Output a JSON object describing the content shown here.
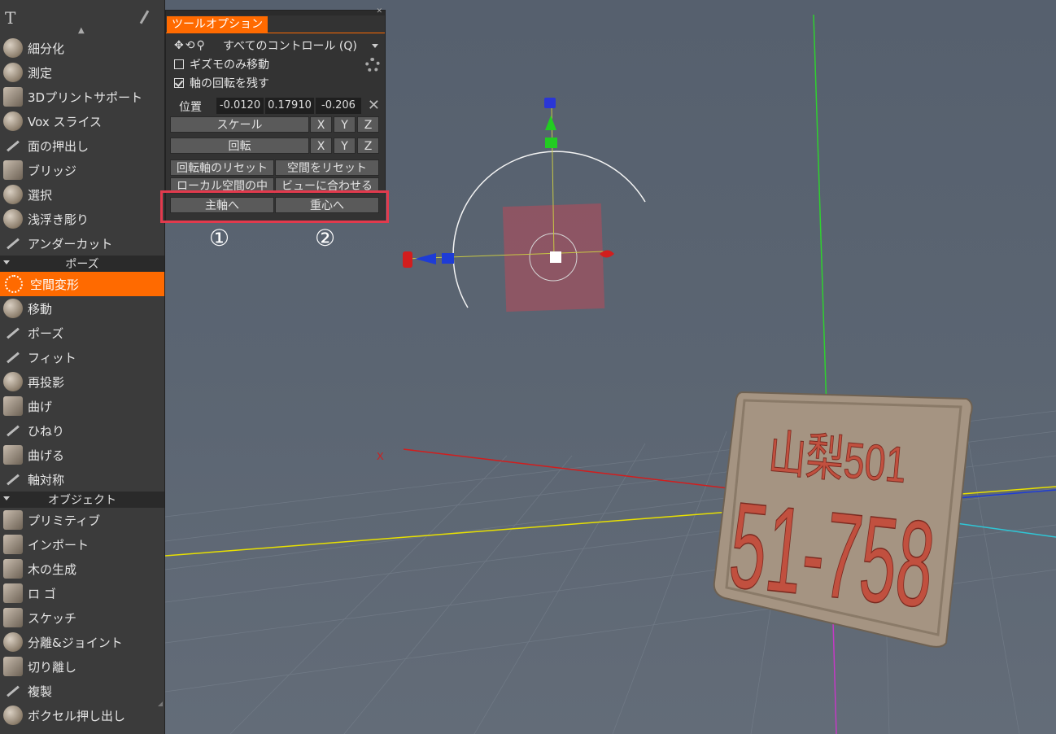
{
  "sidebar": {
    "items_a": [
      {
        "label": "細分化",
        "icon": "subdivide-icon",
        "style": "ball"
      },
      {
        "label": "測定",
        "icon": "measure-icon",
        "style": "ball"
      },
      {
        "label": "3Dプリントサポート",
        "icon": "print-support-icon",
        "style": "flat"
      },
      {
        "label": "Vox スライス",
        "icon": "vox-slice-icon",
        "style": "ball"
      },
      {
        "label": "面の押出し",
        "icon": "face-extrude-icon",
        "style": "thin"
      },
      {
        "label": "ブリッジ",
        "icon": "bridge-icon",
        "style": "flat"
      },
      {
        "label": "選択",
        "icon": "select-icon",
        "style": "ball"
      },
      {
        "label": "浅浮き彫り",
        "icon": "bas-relief-icon",
        "style": "ball"
      },
      {
        "label": "アンダーカット",
        "icon": "undercut-icon",
        "style": "thin"
      }
    ],
    "section_pose": "ポーズ",
    "items_b": [
      {
        "label": "空間変形",
        "icon": "transform-icon",
        "style": "active"
      },
      {
        "label": "移動",
        "icon": "move-icon",
        "style": "ball"
      },
      {
        "label": "ポーズ",
        "icon": "pose-icon",
        "style": "thin"
      },
      {
        "label": "フィット",
        "icon": "fit-icon",
        "style": "thin"
      },
      {
        "label": "再投影",
        "icon": "reproject-icon",
        "style": "ball"
      },
      {
        "label": "曲げ",
        "icon": "bend-icon",
        "style": "flat"
      },
      {
        "label": "ひねり",
        "icon": "twist-icon",
        "style": "thin"
      },
      {
        "label": "曲げる",
        "icon": "curve-icon",
        "style": "flat"
      },
      {
        "label": "軸対称",
        "icon": "axial-symmetry-icon",
        "style": "thin"
      }
    ],
    "section_object": "オブジェクト",
    "items_c": [
      {
        "label": "プリミティブ",
        "icon": "primitives-icon",
        "style": "flat"
      },
      {
        "label": "インポート",
        "icon": "import-icon",
        "style": "flat"
      },
      {
        "label": "木の生成",
        "icon": "tree-icon",
        "style": "flat"
      },
      {
        "label": "ロ ゴ",
        "icon": "logo-icon",
        "style": "flat"
      },
      {
        "label": "スケッチ",
        "icon": "sketch-icon",
        "style": "flat"
      },
      {
        "label": "分離&ジョイント",
        "icon": "split-join-icon",
        "style": "ball"
      },
      {
        "label": "切り離し",
        "icon": "cut-off-icon",
        "style": "flat"
      },
      {
        "label": "複製",
        "icon": "clone-icon",
        "style": "thin"
      },
      {
        "label": "ボクセル押し出し",
        "icon": "voxel-extrude-icon",
        "style": "ball"
      }
    ]
  },
  "panel": {
    "tab": "ツールオプション",
    "control_mode": "すべてのコントロール (Q)",
    "gizmo_only": "ギズモのみ移動",
    "keep_rotation": "軸の回転を残す",
    "position_label": "位置",
    "pos_x": "-0.0120",
    "pos_y": "0.17910",
    "pos_z": "-0.206",
    "scale": "スケール",
    "rotate": "回転",
    "axis_x": "X",
    "axis_y": "Y",
    "axis_z": "Z",
    "reset_rotation_axis": "回転軸のリセット",
    "reset_space": "空間をリセット",
    "local_space_center": "ローカル空間の中",
    "fit_to_view": "ビューに合わせる",
    "to_principal_axis": "主軸へ",
    "to_center_of_mass": "重心へ"
  },
  "annotations": {
    "n1": "①",
    "n2": "②"
  },
  "viewport": {
    "axis_label_x": "X",
    "plate_top": "山梨501",
    "plate_bottom": "51-758"
  },
  "colors": {
    "accent": "#ff6a00",
    "highlight": "#e23a4d",
    "plate": "#a59482",
    "plate_text": "#c1503f"
  }
}
